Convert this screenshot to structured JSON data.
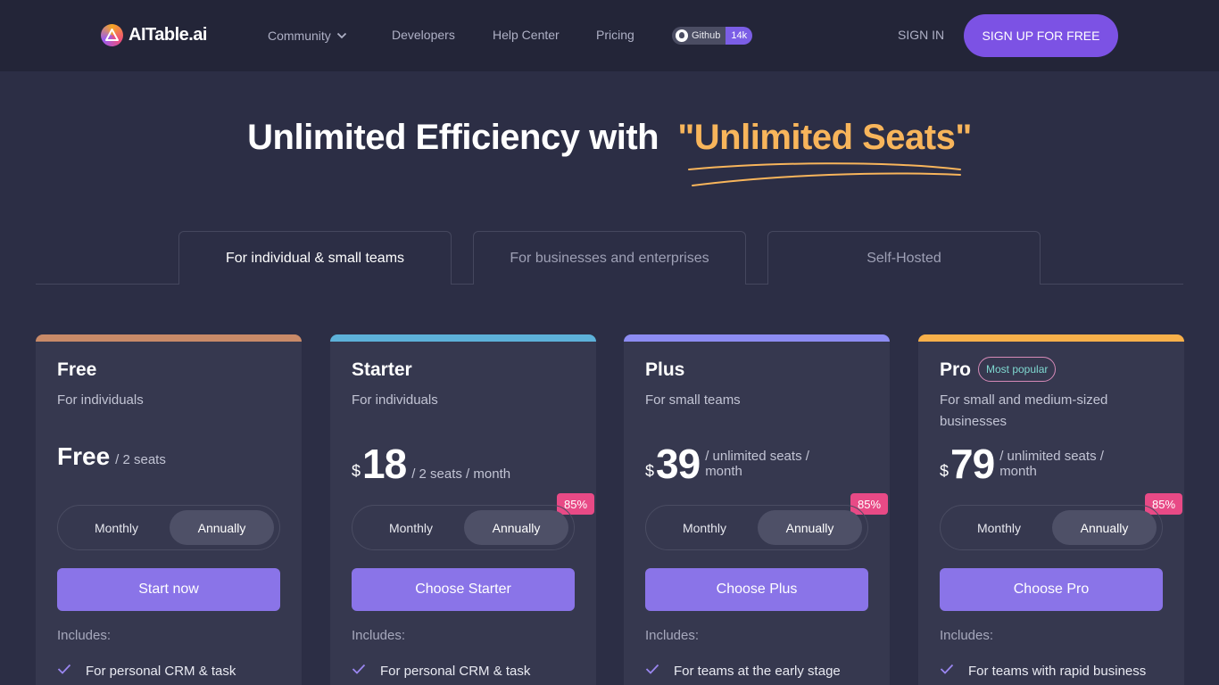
{
  "nav": {
    "brand": "AITable.ai",
    "links": [
      "Community",
      "Developers",
      "Help Center",
      "Pricing"
    ],
    "github_label": "Github",
    "github_count": "14k",
    "signin": "SIGN IN",
    "signup": "SIGN UP FOR FREE"
  },
  "hero": {
    "title_main": "Unlimited Efficiency with",
    "title_accent": "\"Unlimited Seats\""
  },
  "tabs": [
    "For individual & small teams",
    "For businesses and enterprises",
    "Self-Hosted"
  ],
  "active_tab": "For individual & small teams",
  "plans": [
    {
      "name": "Free",
      "subtitle": "For individuals",
      "price_text": "Free",
      "unit": "/ 2  seats",
      "toggle": [
        "Monthly",
        "Annually"
      ],
      "cta": "Start now",
      "includes": "Includes:",
      "feature": "For personal CRM & task",
      "accent_color": "#c98a68"
    },
    {
      "name": "Starter",
      "subtitle": "For individuals",
      "currency": "$",
      "price": "18",
      "unit": "/ 2  seats  / month",
      "discount": "85%",
      "toggle": [
        "Monthly",
        "Annually"
      ],
      "cta": "Choose Starter",
      "includes": "Includes:",
      "feature": "For personal CRM & task",
      "accent_color": "#5db1d9"
    },
    {
      "name": "Plus",
      "subtitle": "For small teams",
      "currency": "$",
      "price": "39",
      "unit": "/ unlimited  seats  / month",
      "discount": "85%",
      "toggle": [
        "Monthly",
        "Annually"
      ],
      "cta": "Choose Plus",
      "includes": "Includes:",
      "feature": "For teams at the early stage",
      "accent_color": "#8d8cf2"
    },
    {
      "name": "Pro",
      "badge": "Most popular",
      "subtitle": "For small and medium-sized businesses",
      "currency": "$",
      "price": "79",
      "unit": "/ unlimited  seats  / month",
      "discount": "85%",
      "toggle": [
        "Monthly",
        "Annually"
      ],
      "cta": "Choose Pro",
      "includes": "Includes:",
      "feature": "For teams with rapid business",
      "accent_color": "#f8b04a"
    }
  ],
  "selected_billing": "Annually"
}
